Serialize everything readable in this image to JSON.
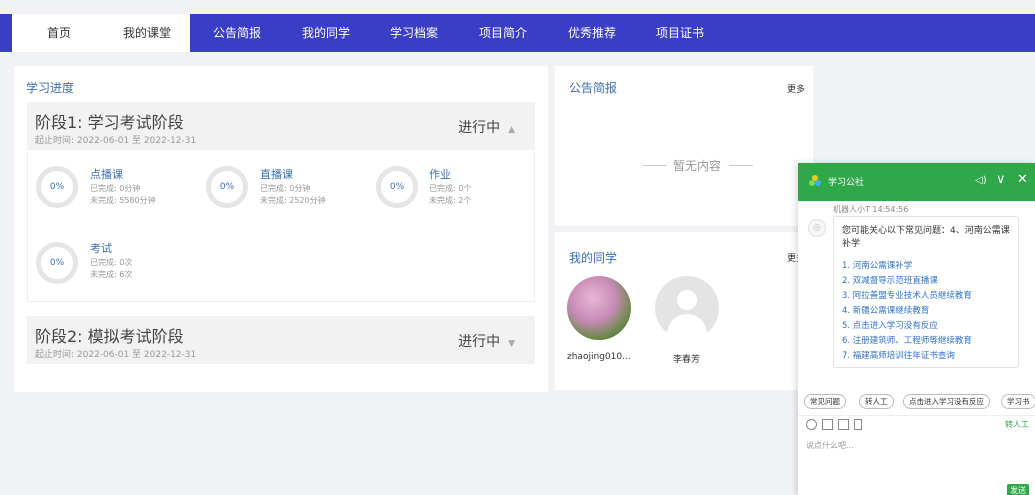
{
  "nav": {
    "items": [
      "首页",
      "我的课堂",
      "公告简报",
      "我的同学",
      "学习档案",
      "项目简介",
      "优秀推荐",
      "项目证书"
    ]
  },
  "progress": {
    "title": "学习进度",
    "stage1": {
      "name": "阶段1:  学习考试阶段",
      "time": "起止时间:  2022-06-01 至 2022-12-31",
      "status": "进行中",
      "status_arrow": "▲",
      "items": [
        {
          "pct": "0%",
          "title": "点播课",
          "done": "已完成: 0分钟",
          "todo": "未完成: 5580分钟"
        },
        {
          "pct": "0%",
          "title": "直播课",
          "done": "已完成: 0分钟",
          "todo": "未完成: 2520分钟"
        },
        {
          "pct": "0%",
          "title": "作业",
          "done": "已完成: 0个",
          "todo": "未完成: 2个"
        },
        {
          "pct": "0%",
          "title": "考试",
          "done": "已完成: 0次",
          "todo": "未完成: 6次"
        }
      ]
    },
    "stage2": {
      "name": "阶段2:  模拟考试阶段",
      "time": "起止时间:  2022-06-01 至 2022-12-31",
      "status": "进行中",
      "status_arrow": "▼"
    }
  },
  "notice": {
    "title": "公告简报",
    "more": "更多",
    "empty": "暂无内容"
  },
  "classmates": {
    "title": "我的同学",
    "more": "更多",
    "list": [
      {
        "name": "zhaojing010..."
      },
      {
        "name": "李春芳"
      }
    ]
  },
  "chat": {
    "title": "学习公社",
    "controls": {
      "sound": "◁)",
      "collapse": "∨",
      "close": "✕"
    },
    "bot_meta": "机器人小T  14:54:56",
    "question": "您可能关心以下常见问题：4、河南公需课补学",
    "links": [
      "1. 河南公需课补学",
      "2. 双减督导示范班直播课",
      "3. 阿拉善盟专业技术人员继续教育",
      "4. 新疆公需课继续教育",
      "5. 点击进入学习没有反应",
      "6. 注册建筑师、工程师等继续教育",
      "7. 福建高师培训往年证书查询"
    ],
    "chips": [
      "常见问题",
      "转人工",
      "点击进入学习没有反应",
      "学习书"
    ],
    "to_human": "转人工",
    "input_placeholder": "说点什么吧...",
    "send": "发送"
  },
  "colors": {
    "nav_bg": "#3a3dc5",
    "chat_green": "#2fa84a",
    "link_blue": "#2f73c8"
  }
}
